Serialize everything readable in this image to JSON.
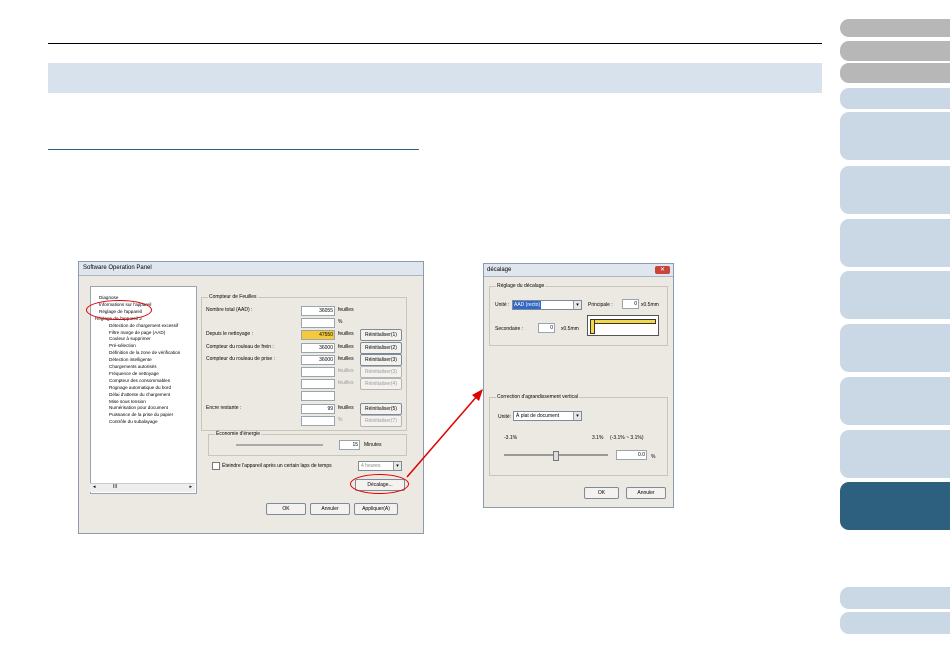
{
  "side_tabs": [
    {
      "style": "gray"
    },
    {
      "style": "gray"
    },
    {
      "style": "gray"
    },
    {
      "style": "light"
    },
    {
      "style": "light"
    },
    {
      "style": "light"
    },
    {
      "style": "light"
    },
    {
      "style": "light"
    },
    {
      "style": "light"
    },
    {
      "style": "light"
    },
    {
      "style": "light"
    },
    {
      "style": "dark"
    },
    {
      "style": "light"
    },
    {
      "style": "light"
    }
  ],
  "colors": {
    "banner": "#d8e2ec",
    "tab_light": "#c9d8e4",
    "tab_gray": "#b7b7b7",
    "tab_dark": "#2d5f7e",
    "highlight": "#f5c93a",
    "annotation_red": "#e00000"
  },
  "panel": {
    "title": "Software Operation Panel",
    "tree": [
      "Diagnose",
      "Informations sur l'appareil",
      "Réglage de l'appareil",
      "Réglage de l'appareil 2",
      "Détection de chargement excessif",
      "Filtre marge de page (AAD)",
      "Couleur à supprimer",
      "Pré-sélection",
      "Définition de la zone de vérification",
      "Détection intelligente",
      "Chargements autorisés",
      "Fréquence de nettoyage",
      "Compteur des consommables",
      "Rognage automatique du bord",
      "Délai d'attente du chargement",
      "Mise sous tension",
      "Numérisation pour document",
      "Puissance de la prise du papier",
      "Contrôle du subalayage"
    ],
    "scroll_mark": "III",
    "counter_group": "Compteur de Feuilles",
    "rows": [
      {
        "label": "Nombre total (AAD) :",
        "value": "36055",
        "unit": "feuilles",
        "button": ""
      },
      {
        "label": "",
        "value": "",
        "unit": "%",
        "button": ""
      },
      {
        "label": "Depuis le nettoyage :",
        "value": "47550",
        "unit": "feuilles",
        "button": "Réinitialiser(1)"
      },
      {
        "label": "Compteur du rouleau de frein :",
        "value": "36000",
        "unit": "feuilles",
        "button": "Réinitialiser(2)"
      },
      {
        "label": "Compteur du rouleau de prise :",
        "value": "36000",
        "unit": "feuilles",
        "button": "Réinitialiser(3)"
      },
      {
        "label": "",
        "value": "",
        "unit": "feuilles",
        "button": "Réinitialiser(3)"
      },
      {
        "label": "",
        "value": "",
        "unit": "feuilles",
        "button": "Réinitialiser(4)"
      },
      {
        "label": "",
        "value": "",
        "unit": "",
        "button": ""
      },
      {
        "label": "Encre restante :",
        "value": "99",
        "unit": "feuilles",
        "button": "Réinitialiser(5)"
      },
      {
        "label": "",
        "value": "",
        "unit": "%",
        "button": "Réinitialiser(7)"
      }
    ],
    "energy_group": "Économie d'énergie",
    "energy_value": "15",
    "energy_unit": "Minutes",
    "shutdown_label": "Éteindre l'appareil après un certain laps de temps",
    "shutdown_select": "4 heures",
    "decalage_button": "Décalage...",
    "ok": "OK",
    "cancel": "Annuler",
    "apply": "Appliquer(A)"
  },
  "decalage": {
    "title": "décalage",
    "close": "✕",
    "group1": "Réglage du décalage",
    "unit_label": "Unité :",
    "unit_value": "AAD (recto)",
    "main_label": "Principale :",
    "main_value": "0",
    "main_unit": "x0.5mm",
    "sec_label": "Secondaire :",
    "sec_value": "0",
    "sec_unit": "x0.5mm",
    "group2": "Correction d'agrandissement vertical",
    "unit2_label": "Unité:",
    "unit2_value": "À plat de document",
    "min": "-3.1%",
    "max": "3.1%",
    "range": "(-3.1% ~ 3.1%)",
    "value": "0.0",
    "pct": "%",
    "ok": "OK",
    "cancel": "Annuler"
  }
}
